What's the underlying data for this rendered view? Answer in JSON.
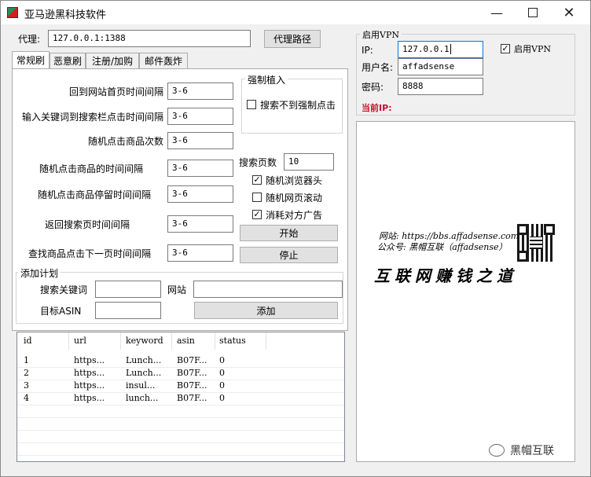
{
  "window": {
    "title": "亚马逊黑科技软件"
  },
  "proxy": {
    "label": "代理:",
    "value": "127.0.0.1:1388",
    "path_button": "代理路径"
  },
  "tabs": [
    {
      "label": "常规刷"
    },
    {
      "label": "恶意刷"
    },
    {
      "label": "注册/加购"
    },
    {
      "label": "邮件轰炸"
    }
  ],
  "settings": [
    {
      "label": "回到网站首页时间间隔",
      "value": "3-6"
    },
    {
      "label": "输入关键词到搜索栏点击时间间隔",
      "value": "3-6"
    },
    {
      "label": "随机点击商品次数",
      "value": "3-6"
    },
    {
      "label": "随机点击商品的时间间隔",
      "value": "3-6"
    },
    {
      "label": "随机点击商品停留时间间隔",
      "value": "3-6"
    },
    {
      "label": "返回搜索页时间间隔",
      "value": "3-6"
    },
    {
      "label": "查找商品点击下一页时间间隔",
      "value": "3-6"
    }
  ],
  "force": {
    "title": "强制植入",
    "checkbox_label": "搜索不到强制点击",
    "checked": false
  },
  "search_pages": {
    "label": "搜索页数",
    "value": "10"
  },
  "options": [
    {
      "label": "随机浏览器头",
      "checked": true
    },
    {
      "label": "随机网页滚动",
      "checked": false
    },
    {
      "label": "消耗对方广告",
      "checked": true
    }
  ],
  "actions": {
    "start": "开始",
    "stop": "停止"
  },
  "plan": {
    "title": "添加计划",
    "keyword_label": "搜索关键词",
    "keyword_value": "",
    "site_label": "网站",
    "site_value": "",
    "asin_label": "目标ASIN",
    "asin_value": "",
    "add_button": "添加"
  },
  "table": {
    "columns": [
      "id",
      "url",
      "keyword",
      "asin",
      "status"
    ],
    "rows": [
      [
        "1",
        "https...",
        "Lunch...",
        "B07F...",
        "0"
      ],
      [
        "2",
        "https...",
        "Lunch...",
        "B07F...",
        "0"
      ],
      [
        "3",
        "https...",
        "insul...",
        "B07F...",
        "0"
      ],
      [
        "4",
        "https...",
        "lunch...",
        "B07F...",
        "0"
      ]
    ]
  },
  "vpn": {
    "group_title": "启用VPN",
    "ip_label": "IP:",
    "ip_value": "127.0.0.1",
    "user_label": "用户名:",
    "user_value": "affadsense",
    "pass_label": "密码:",
    "pass_value": "8888",
    "enable_label": "启用VPN",
    "enable_checked": true,
    "current_ip_label": "当前IP:"
  },
  "promo": {
    "site_line": "网站: https://bbs.affadsense.com",
    "account_line": "公众号: 黑帽互联（affadsense）",
    "slogan": "互联网赚钱之道",
    "watermark": "黑帽互联"
  },
  "colors": {
    "accent": "#0078d7",
    "current_ip": "#c8102e",
    "window_bg": "#f0f0f0"
  }
}
